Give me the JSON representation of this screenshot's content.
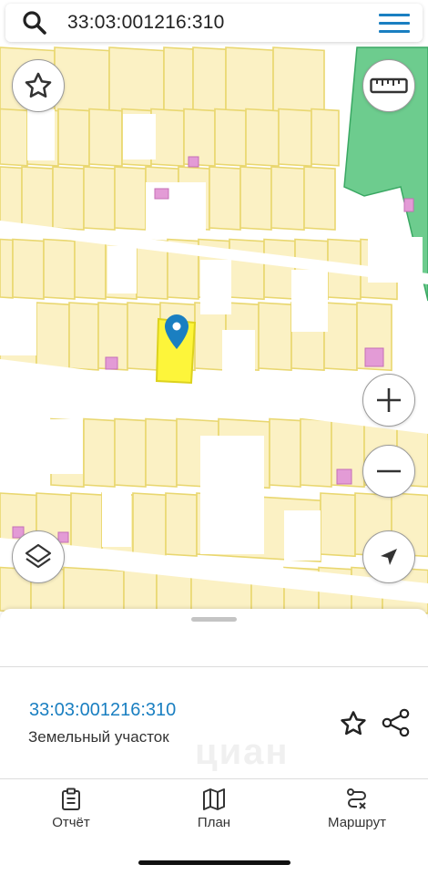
{
  "search": {
    "query": "33:03:001216:310"
  },
  "map": {
    "colors": {
      "parcel_fill": "#fbf1c4",
      "parcel_stroke": "#e9d770",
      "selected_fill": "#fdf53a",
      "selected_stroke": "#dcd21e",
      "building": "#e39bd6",
      "forest": "#6dcc8e",
      "pin": "#1a7fc1"
    }
  },
  "controls": {
    "favorite_icon": "star-icon",
    "ruler_icon": "ruler-icon",
    "zoom_in_icon": "plus-icon",
    "zoom_out_icon": "minus-icon",
    "layers_icon": "layers-icon",
    "locate_icon": "navigation-arrow-icon"
  },
  "card": {
    "parcel_number": "33:03:001216:310",
    "parcel_type": "Земельный участок",
    "watermark": "циан"
  },
  "bottom_nav": {
    "items": [
      {
        "label": "Отчёт",
        "icon": "report-clipboard-icon"
      },
      {
        "label": "План",
        "icon": "map-plan-icon"
      },
      {
        "label": "Маршрут",
        "icon": "route-icon"
      }
    ]
  }
}
